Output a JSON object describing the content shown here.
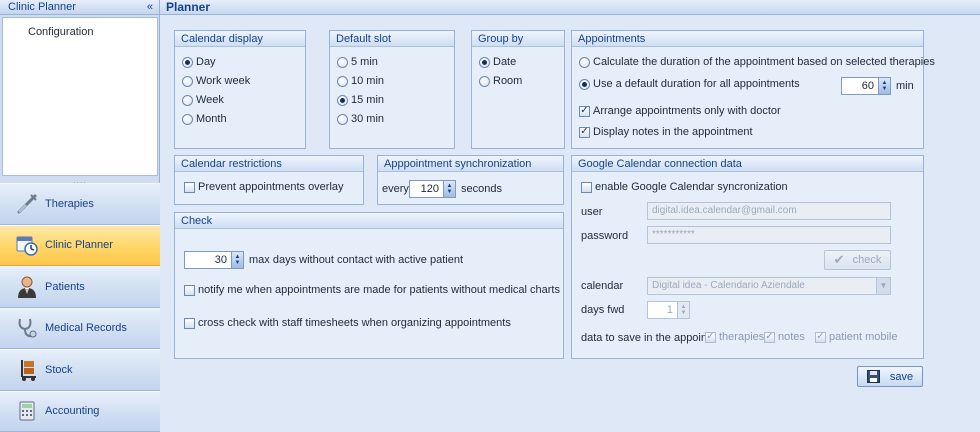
{
  "sidebar": {
    "title": "Clinic Planner",
    "collapse_glyph": "«",
    "tree_items": [
      "Configuration"
    ],
    "splitter": "....",
    "nav": [
      {
        "label": "Therapies",
        "icon": "syringe-icon",
        "active": false
      },
      {
        "label": "Clinic Planner",
        "icon": "calendar-clock-icon",
        "active": true
      },
      {
        "label": "Patients",
        "icon": "person-icon",
        "active": false
      },
      {
        "label": "Medical Records",
        "icon": "stethoscope-icon",
        "active": false
      },
      {
        "label": "Stock",
        "icon": "hand-truck-icon",
        "active": false
      },
      {
        "label": "Accounting",
        "icon": "calculator-icon",
        "active": false
      }
    ]
  },
  "header": {
    "title": "Planner"
  },
  "calendar_display": {
    "title": "Calendar display",
    "options": [
      "Day",
      "Work week",
      "Week",
      "Month"
    ],
    "selected": "Day"
  },
  "default_slot": {
    "title": "Default slot",
    "options": [
      "5 min",
      "10 min",
      "15 min",
      "30 min"
    ],
    "selected": "15 min"
  },
  "group_by": {
    "title": "Group by",
    "options": [
      "Date",
      "Room"
    ],
    "selected": "Date"
  },
  "appointments": {
    "title": "Appointments",
    "opt_calc": "Calculate the duration of the appointment based on selected therapies",
    "opt_default": "Use a default duration for all appointments",
    "selected": "default",
    "duration_value": "60",
    "duration_unit": "min",
    "arrange_label": "Arrange appointments only with doctor",
    "arrange_checked": true,
    "notes_label": "Display notes in the appointment",
    "notes_checked": true
  },
  "restrictions": {
    "title": "Calendar restrictions",
    "overlay_label": "Prevent appointments overlay",
    "overlay_checked": false
  },
  "sync": {
    "title": "Apppointment synchronization",
    "every_label": "every",
    "value": "120",
    "unit": "seconds"
  },
  "check": {
    "title": "Check",
    "days_value": "30",
    "days_label": "max days without contact with active patient",
    "notify_label": "notify me when appointments are made for patients without medical charts",
    "notify_checked": false,
    "cross_label": "cross check with staff timesheets when organizing appointments",
    "cross_checked": false
  },
  "google": {
    "title": "Google Calendar connection data",
    "enable_label": "enable Google Calendar syncronization",
    "enable_checked": false,
    "user_label": "user",
    "user_value": "digital.idea.calendar@gmail.com",
    "password_label": "password",
    "password_value": "***********",
    "check_button": "check",
    "calendar_label": "calendar",
    "calendar_value": "Digital idea - Calendario Aziendale",
    "days_label": "days fwd",
    "days_value": "1",
    "save_data_label": "data to save in the appoint.",
    "save_opts": [
      {
        "label": "therapies",
        "checked": true
      },
      {
        "label": "notes",
        "checked": true
      },
      {
        "label": "patient mobile",
        "checked": true
      }
    ]
  },
  "save_button": "save"
}
